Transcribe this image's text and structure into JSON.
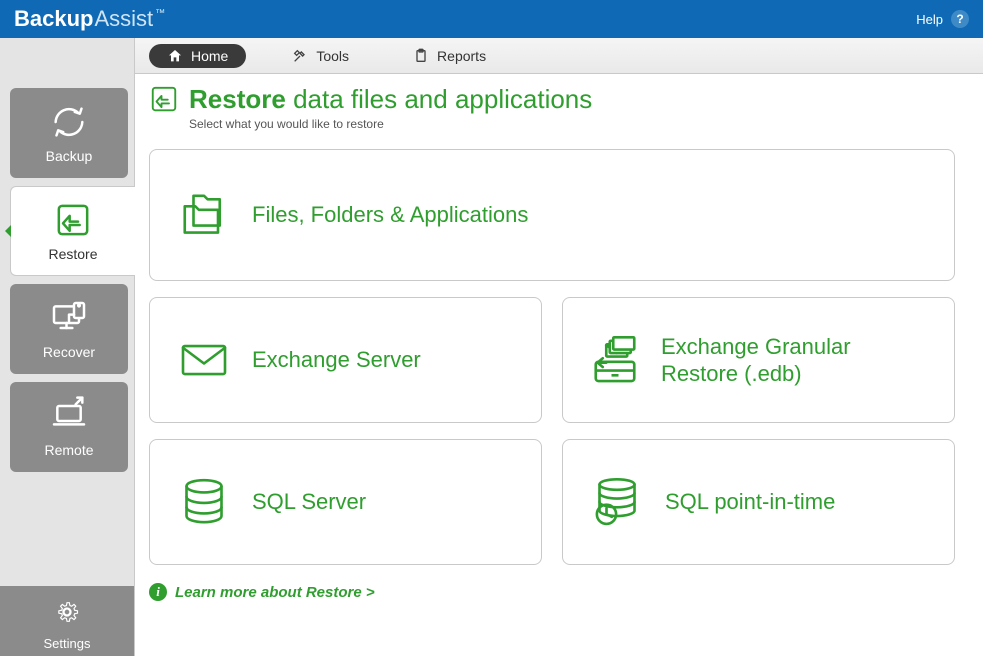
{
  "brand": {
    "word1": "Backup",
    "word2": "Assist",
    "tm": "™"
  },
  "topbar": {
    "help_label": "Help"
  },
  "sidebar": {
    "backup": "Backup",
    "restore": "Restore",
    "recover": "Recover",
    "remote": "Remote",
    "settings": "Settings"
  },
  "tabs": {
    "home": "Home",
    "tools": "Tools",
    "reports": "Reports"
  },
  "heading": {
    "bold": "Restore",
    "rest": "data files and applications",
    "subtitle": "Select what you would like to restore"
  },
  "cards": {
    "files": "Files, Folders & Applications",
    "exchange": "Exchange Server",
    "egr": "Exchange Granular Restore (.edb)",
    "sql": "SQL Server",
    "sqlpit": "SQL point-in-time"
  },
  "footer": {
    "learn_more": "Learn more about Restore >"
  }
}
